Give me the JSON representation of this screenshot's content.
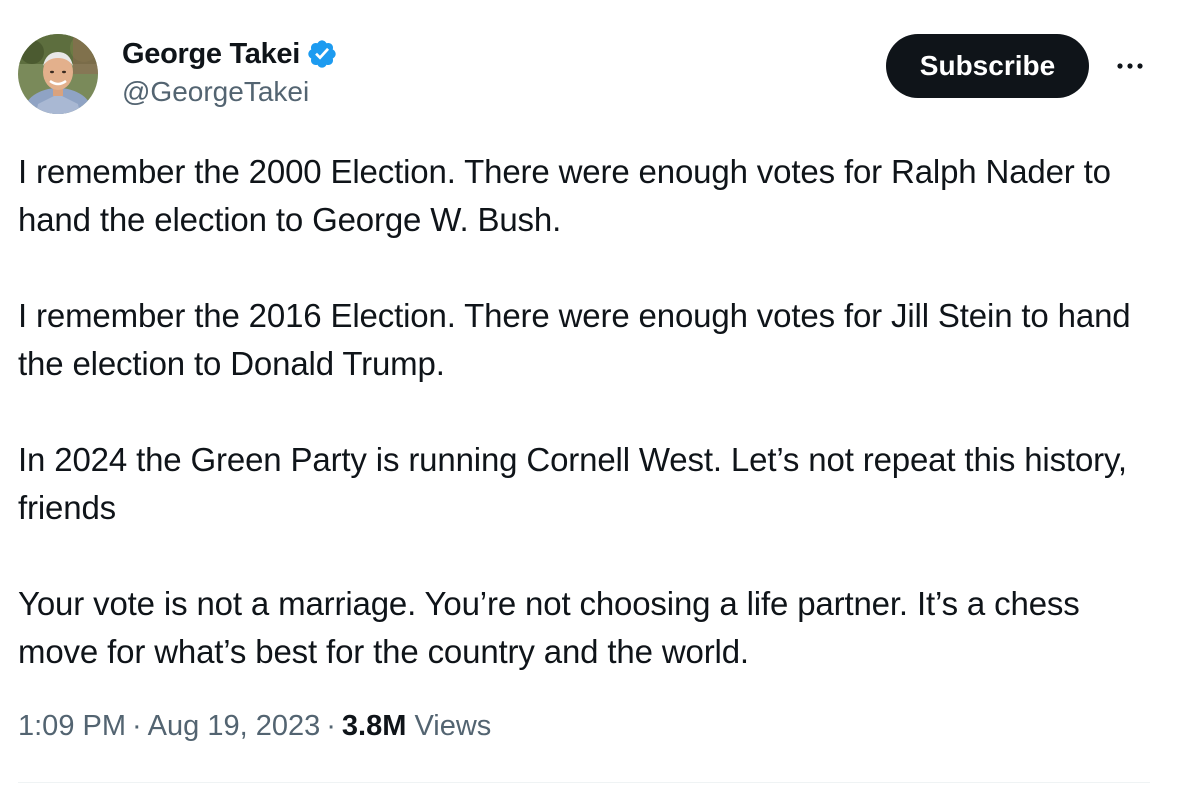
{
  "author": {
    "display_name": "George Takei",
    "handle": "@GeorgeTakei",
    "verified": true
  },
  "actions": {
    "subscribe_label": "Subscribe",
    "more_icon": "more-horizontal-icon"
  },
  "tweet": {
    "paragraphs": [
      "I remember the 2000 Election. There were enough votes for Ralph Nader to hand the election to George W. Bush.",
      "I remember the 2016 Election. There were enough votes for Jill Stein to hand the election to Donald Trump.",
      "In 2024 the Green Party is running Cornell West. Let’s not repeat this history, friends",
      "Your vote is not a marriage. You’re not choosing a life partner. It’s a chess move for what’s best for the country and the world."
    ],
    "time": "1:09 PM",
    "date": "Aug 19, 2023",
    "separator": "·",
    "views_count": "3.8M",
    "views_label": "Views"
  },
  "colors": {
    "text_primary": "#0f1419",
    "text_secondary": "#536471",
    "verified_blue": "#1d9bf0",
    "button_bg": "#0f1419"
  }
}
